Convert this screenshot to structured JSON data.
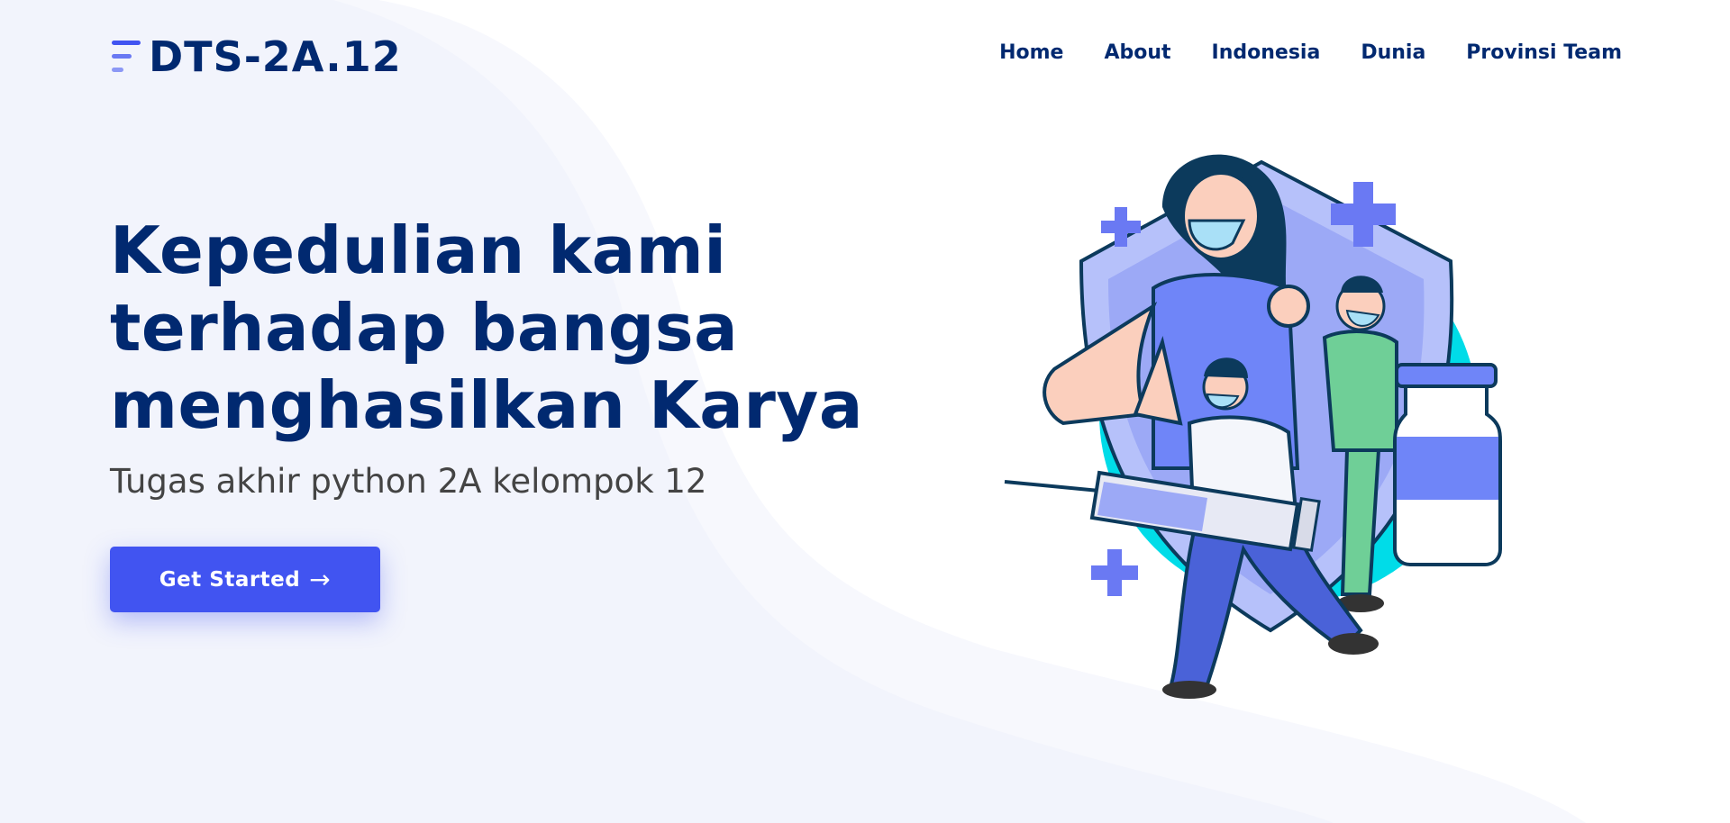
{
  "brand": {
    "name": "DTS-2A.12",
    "icon": "menu-lines-icon"
  },
  "nav": {
    "items": [
      "Home",
      "About",
      "Indonesia",
      "Dunia",
      "Provinsi Team"
    ]
  },
  "hero": {
    "title_lines": [
      "Kepedulian kami",
      "terhadap bangsa",
      "menghasilkan Karya"
    ],
    "subtitle": "Tugas akhir python 2A kelompok 12",
    "cta_label": "Get Started",
    "cta_icon": "arrow-right-icon"
  },
  "illustration": {
    "subject": "vaccination-illustration"
  },
  "colors": {
    "primary": "#4154f1",
    "heading": "#012970",
    "text": "#444444",
    "background_wave": "#f2f4fc",
    "illustration_circle": "#00dce8",
    "shield": "#b6c1fa"
  }
}
